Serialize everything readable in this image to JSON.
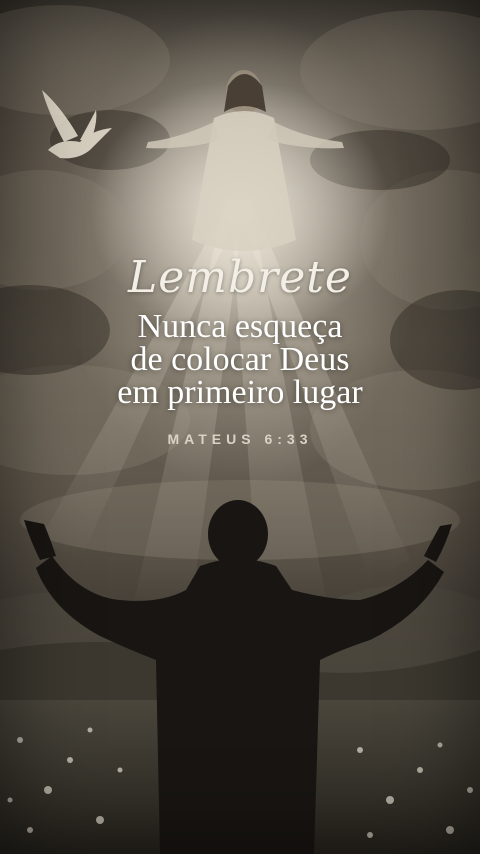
{
  "title": "Lembrete",
  "message_lines": [
    "Nunca esqueça",
    "de colocar Deus",
    "em primeiro lugar"
  ],
  "reference": "MATEUS 6:33",
  "colors": {
    "text_primary": "#ffffff",
    "text_reference": "#d9d3c6",
    "sky_light": "#ebe4d4",
    "silhouette": "#181512"
  },
  "illustration": [
    "clouds",
    "light-rays",
    "jesus-figure",
    "dove",
    "man-raising-arms",
    "flower-field",
    "hills"
  ]
}
